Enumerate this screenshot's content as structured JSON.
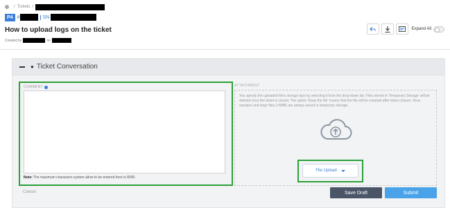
{
  "breadcrumb": {
    "separator": "/",
    "section": "Tickets"
  },
  "ticket": {
    "priority": "P4",
    "hash": "#",
    "sn_label": "SN"
  },
  "title": "How to upload logs on the ticket",
  "created": {
    "prefix": "Created by",
    "on": "on"
  },
  "toolbar": {
    "expand_all": "Expand All",
    "reply_icon": "reply-icon",
    "download_icon": "download-icon",
    "layout_icon": "layout-icon"
  },
  "panel": {
    "title": "Ticket Conversation",
    "collapse_icon": "minus-icon",
    "section_icon": "conversation-icon"
  },
  "comment": {
    "label": "COMMENT",
    "note_bold": "Note:",
    "note_text": "The maximum characters system allow to be entered here is 8000.",
    "value": ""
  },
  "attachment": {
    "label": "ATTACHMENT",
    "description": "You specify the uploaded file's storage type by selecting it from the drop-down list. Files stored in 'Temporary Storage' will be deleted once the ticket is closed. The option 'Keep the file' means that the file will be retained after ticket closure. Virus samples and large files (>5MB) are always saved in temporary storage.",
    "upload_label": "File Upload"
  },
  "actions": {
    "cancel": "Cancel",
    "save_draft": "Save Draft",
    "submit": "Submit"
  },
  "colors": {
    "accent": "#3b7dd8",
    "highlight": "#29a037",
    "draft": "#4a5568",
    "submit": "#4aa3e8"
  }
}
